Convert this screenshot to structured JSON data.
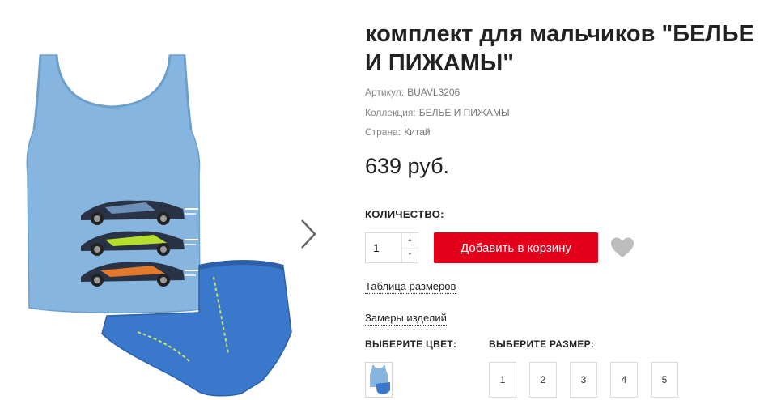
{
  "product": {
    "title": "комплект для мальчиков \"БЕЛЬЕ И ПИЖАМЫ\"",
    "image_alt": "голубая майка с машинками и синие трусы",
    "price": "639 руб."
  },
  "meta": {
    "sku_label": "Артикул:",
    "sku_value": "BUAVL3206",
    "collection_label": "Коллекция:",
    "collection_value": "БЕЛЬЕ И ПИЖАМЫ",
    "country_label": "Страна:",
    "country_value": "Китай"
  },
  "purchase": {
    "quantity_label": "КОЛИЧЕСТВО:",
    "quantity_value": "1",
    "add_to_cart_label": "Добавить в корзину"
  },
  "links": {
    "size_table": "Таблица размеров",
    "measurements": "Замеры изделий"
  },
  "options": {
    "color_label": "ВЫБЕРИТЕ ЦВЕТ:",
    "size_label": "ВЫБЕРИТЕ РАЗМЕР:",
    "sizes": [
      "1",
      "2",
      "3",
      "4",
      "5"
    ]
  },
  "icons": {
    "next": "chevron-right-icon",
    "wishlist": "heart-icon",
    "qty_up": "caret-up-icon",
    "qty_down": "caret-down-icon"
  },
  "colors": {
    "accent": "#e3001b",
    "tank_top": "#86b6e0",
    "briefs": "#3a78cc",
    "heart": "#bdbdbd"
  }
}
